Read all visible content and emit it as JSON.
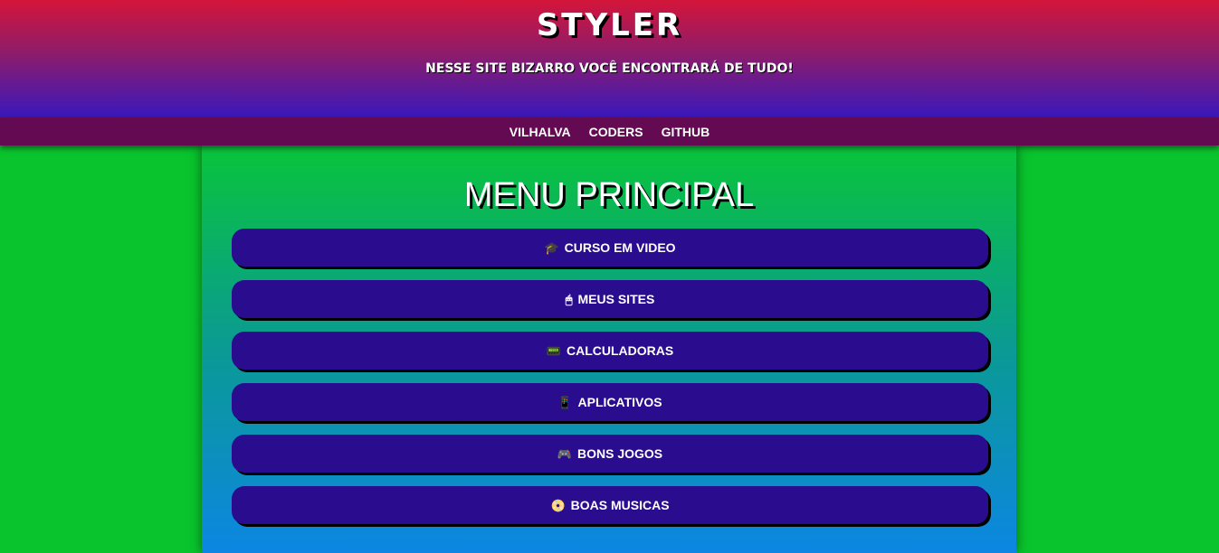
{
  "header": {
    "title": "STYLER",
    "subtitle": "NESSE SITE BIZARRO VOCÊ ENCONTRARÁ DE TUDO!"
  },
  "nav": {
    "items": [
      {
        "label": "VILHALVA"
      },
      {
        "label": "CODERS"
      },
      {
        "label": "GITHUB"
      }
    ]
  },
  "main": {
    "title": "MENU PRINCIPAL",
    "menu": [
      {
        "icon": "🎓",
        "icon_name": "graduation-cap-icon",
        "label": "CURSO EM VIDEO"
      },
      {
        "icon": "🖱",
        "icon_name": "mouse-icon",
        "label": "MEUS SITES"
      },
      {
        "icon": "📟",
        "icon_name": "calculator-icon",
        "label": "CALCULADORAS"
      },
      {
        "icon": "📱",
        "icon_name": "mobile-phone-icon",
        "label": "APLICATIVOS"
      },
      {
        "icon": "🎮",
        "icon_name": "game-controller-icon",
        "label": "BONS JOGOS"
      },
      {
        "icon": "📀",
        "icon_name": "disc-icon",
        "label": "BOAS MUSICAS"
      }
    ]
  },
  "colors": {
    "header_top": "#d4153a",
    "header_bottom": "#3a18bc",
    "nav_bg": "#640a52",
    "page_bg": "#09c42d",
    "button_bg": "#2a0d8e"
  }
}
